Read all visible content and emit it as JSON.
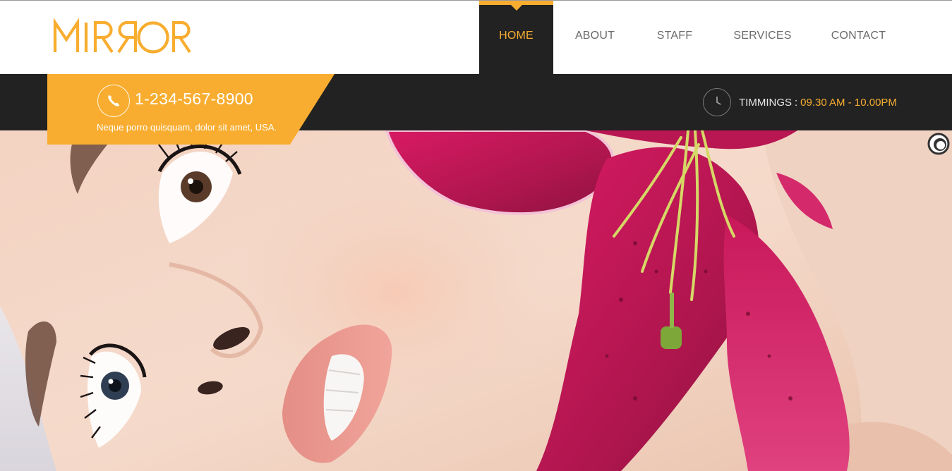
{
  "brand": {
    "logo_text": "MIRROR",
    "color": "#f8ad30"
  },
  "nav": {
    "items": [
      {
        "label": "HOME",
        "active": true
      },
      {
        "label": "ABOUT",
        "active": false
      },
      {
        "label": "STAFF",
        "active": false
      },
      {
        "label": "SERVICES",
        "active": false
      },
      {
        "label": "CONTACT",
        "active": false
      }
    ]
  },
  "contact": {
    "phone": "1-234-567-8900",
    "address": "Neque porro quisquam, dolor sit amet, USA.",
    "icon": "phone-icon"
  },
  "timings": {
    "label": "TIMMINGS",
    "separator": ":",
    "value": "09.30 AM - 10.00PM",
    "icon": "clock-icon"
  },
  "hero": {
    "image": "woman-with-pink-lily-photo"
  },
  "widgets": {
    "scroll_icon": "ring-icon"
  },
  "colors": {
    "accent": "#f8ad30",
    "dark_bar": "#222222",
    "nav_text": "#6b6b6b"
  }
}
